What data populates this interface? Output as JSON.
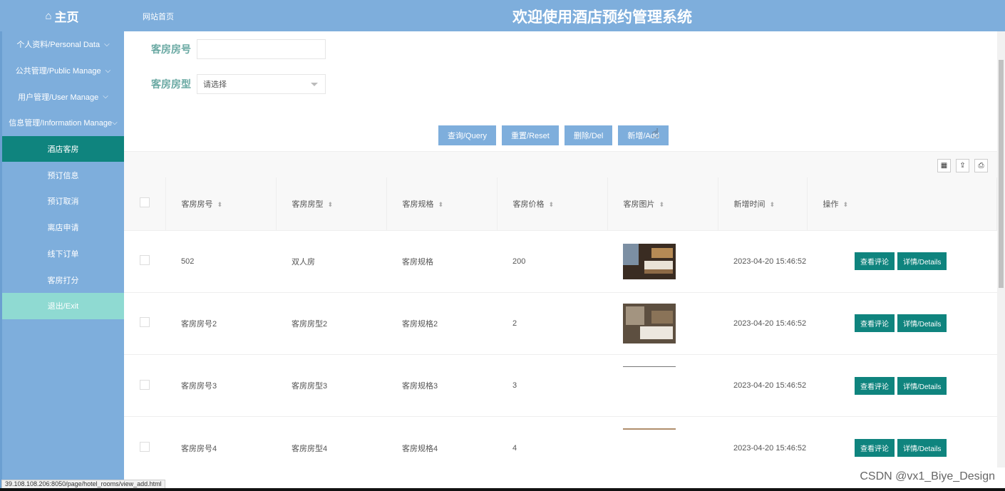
{
  "header": {
    "brand": "主页",
    "site_link": "网站首页",
    "title": "欢迎使用酒店预约管理系统"
  },
  "sidebar": {
    "groups": [
      {
        "label": "个人资料/Personal Data"
      },
      {
        "label": "公共管理/Public Manage"
      },
      {
        "label": "用户管理/User Manage"
      },
      {
        "label": "信息管理/Information Manage"
      }
    ],
    "sub_items": [
      {
        "label": "酒店客房",
        "active": true
      },
      {
        "label": "预订信息"
      },
      {
        "label": "预订取消"
      },
      {
        "label": "离店申请"
      },
      {
        "label": "线下订单"
      },
      {
        "label": "客房打分"
      }
    ],
    "exit": "退出/Exit"
  },
  "search": {
    "room_no_label": "客房房号",
    "room_no_value": "",
    "room_type_label": "客房房型",
    "room_type_value": "请选择"
  },
  "buttons": {
    "query": "查询/Query",
    "reset": "重置/Reset",
    "delete": "删除/Del",
    "add": "新增/Add"
  },
  "table": {
    "headers": [
      "客房房号",
      "客房房型",
      "客房规格",
      "客房价格",
      "客房图片",
      "新增时间",
      "操作"
    ],
    "rows": [
      {
        "no": "502",
        "type": "双人房",
        "spec": "客房规格",
        "price": "200",
        "time": "2023-04-20 15:46:52"
      },
      {
        "no": "客房房号2",
        "type": "客房房型2",
        "spec": "客房规格2",
        "price": "2",
        "time": "2023-04-20 15:46:52"
      },
      {
        "no": "客房房号3",
        "type": "客房房型3",
        "spec": "客房规格3",
        "price": "3",
        "time": "2023-04-20 15:46:52"
      },
      {
        "no": "客房房号4",
        "type": "客房房型4",
        "spec": "客房规格4",
        "price": "4",
        "time": "2023-04-20 15:46:52"
      }
    ],
    "op_view": "查看评论",
    "op_details": "详情/Details"
  },
  "status_url": "39.108.108.206:8050/page/hotel_rooms/view_add.html",
  "watermark": "CSDN @vx1_Biye_Design",
  "colors": {
    "header": "#7eaedc",
    "active": "#0f847e",
    "exit": "#8fdad2",
    "label": "#6aa9a3"
  }
}
